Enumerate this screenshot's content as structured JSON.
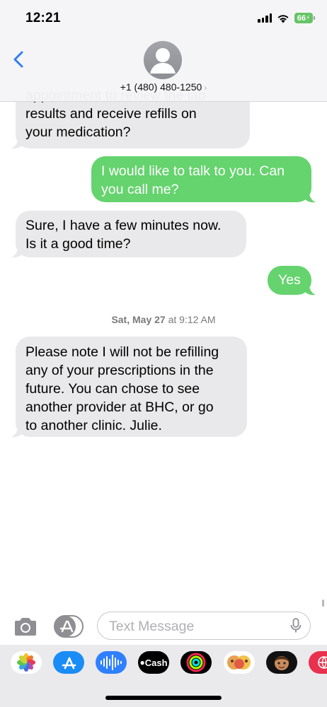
{
  "status": {
    "time": "12:21",
    "battery": "66"
  },
  "header": {
    "phone": "+1 (480) 480-1250"
  },
  "messages": [
    {
      "from": "them",
      "lines": [
        "appointment to review the lab",
        "results and receive refills on",
        "your medication?"
      ]
    },
    {
      "from": "me",
      "lines": [
        "I would like to talk to you. Can",
        "you call me?"
      ]
    },
    {
      "from": "them",
      "lines": [
        "Sure, I have a few minutes now.",
        "Is it a good time?"
      ]
    },
    {
      "from": "me",
      "lines": [
        "Yes"
      ]
    },
    {
      "from": "them",
      "lines": [
        "Please note I will not be refilling",
        "any of your prescriptions in the",
        "future. You can chose to see",
        "another provider at BHC, or go",
        "to another clinic. Julie."
      ]
    }
  ],
  "timestamp": {
    "day": "Sat, May 27",
    "at": "at",
    "time": "9:12 AM"
  },
  "composer": {
    "placeholder": "Text Message"
  },
  "apps": [
    {
      "name": "photos",
      "color": "#ffffff"
    },
    {
      "name": "app-store",
      "color": "#1a8cf5"
    },
    {
      "name": "audio-message",
      "color": "#2f80ff"
    },
    {
      "name": "cash",
      "color": "#000000",
      "label": "Cash"
    },
    {
      "name": "fitness",
      "color": "#000000"
    },
    {
      "name": "memoji-stickers",
      "color": "#ffffff"
    },
    {
      "name": "memoji",
      "color": "#111111"
    },
    {
      "name": "web",
      "color": "#e8314e"
    }
  ]
}
